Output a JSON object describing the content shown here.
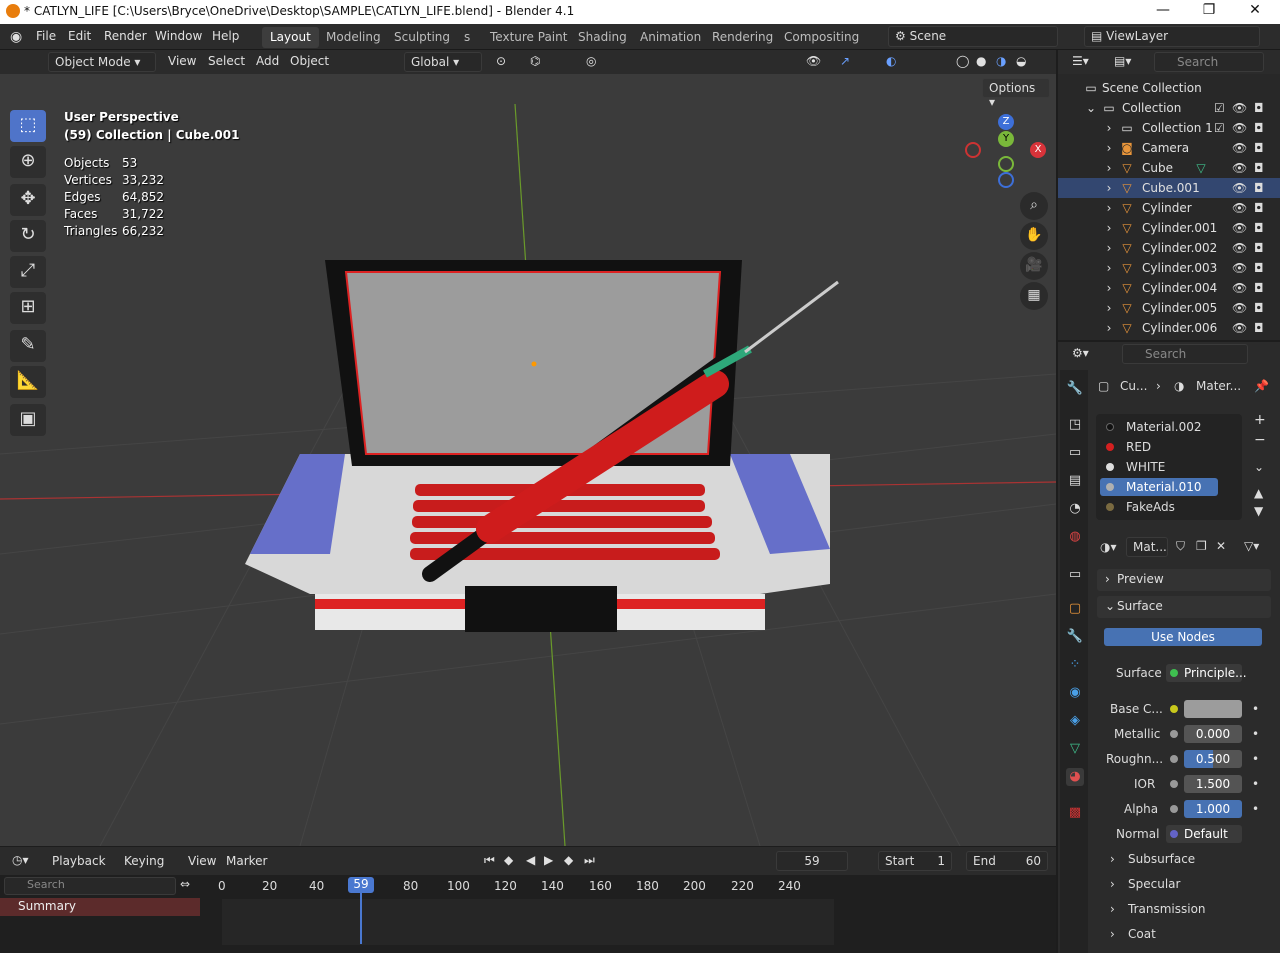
{
  "window": {
    "title": "* CATLYN_LIFE [C:\\Users\\Bryce\\OneDrive\\Desktop\\SAMPLE\\CATLYN_LIFE.blend] - Blender 4.1",
    "minimize": "—",
    "maximize": "❐",
    "close": "✕"
  },
  "menu": [
    "File",
    "Edit",
    "Render",
    "Window",
    "Help"
  ],
  "workspaces": [
    "Layout",
    "Modeling",
    "Sculpting",
    "s",
    "Texture Paint",
    "Shading",
    "Animation",
    "Rendering",
    "Compositing"
  ],
  "scene": {
    "label": "Scene",
    "viewlayer": "ViewLayer"
  },
  "viewport_header": {
    "mode": "Object Mode",
    "menus": [
      "View",
      "Select",
      "Add",
      "Object"
    ],
    "orientation": "Global",
    "options": "Options"
  },
  "overlay": {
    "perspective": "User Perspective",
    "collection": "(59) Collection | Cube.001",
    "stats": [
      {
        "k": "Objects",
        "v": "53"
      },
      {
        "k": "Vertices",
        "v": "33,232"
      },
      {
        "k": "Edges",
        "v": "64,852"
      },
      {
        "k": "Faces",
        "v": "31,722"
      },
      {
        "k": "Triangles",
        "v": "66,232"
      }
    ]
  },
  "gizmo": {
    "x": "X",
    "y": "Y",
    "z": "Z"
  },
  "outliner": {
    "search": "Search",
    "root": "Scene Collection",
    "items": [
      {
        "name": "Collection",
        "icon": "collection-icon"
      },
      {
        "name": "Collection 1",
        "icon": "collection-icon"
      },
      {
        "name": "Camera",
        "icon": "camera-icon"
      },
      {
        "name": "Cube",
        "icon": "mesh-icon"
      },
      {
        "name": "Cube.001",
        "icon": "mesh-icon"
      },
      {
        "name": "Cylinder",
        "icon": "mesh-icon"
      },
      {
        "name": "Cylinder.001",
        "icon": "mesh-icon"
      },
      {
        "name": "Cylinder.002",
        "icon": "mesh-icon"
      },
      {
        "name": "Cylinder.003",
        "icon": "mesh-icon"
      },
      {
        "name": "Cylinder.004",
        "icon": "mesh-icon"
      },
      {
        "name": "Cylinder.005",
        "icon": "mesh-icon"
      },
      {
        "name": "Cylinder.006",
        "icon": "mesh-icon"
      }
    ]
  },
  "properties": {
    "search": "Search",
    "breadcrumb_obj": "Cu...",
    "breadcrumb_mat": "Mater...",
    "materials": [
      {
        "name": "Material.002",
        "color": "#111111"
      },
      {
        "name": "RED",
        "color": "#d42020"
      },
      {
        "name": "WHITE",
        "color": "#dddddd"
      },
      {
        "name": "Material.010",
        "color": "#b0b0b0"
      },
      {
        "name": "FakeAds",
        "color": "#7a6a40"
      }
    ],
    "mat_slot": "Mat...",
    "preview": "Preview",
    "surface": "Surface",
    "use_nodes": "Use Nodes",
    "surface_label": "Surface",
    "surface_value": "Principle...",
    "fields": [
      {
        "label": "Base C...",
        "value": "",
        "dot": "#c8c81c"
      },
      {
        "label": "Metallic",
        "value": "0.000",
        "dot": "#999"
      },
      {
        "label": "Roughn...",
        "value": "0.500",
        "dot": "#999"
      },
      {
        "label": "IOR",
        "value": "1.500",
        "dot": "#999"
      },
      {
        "label": "Alpha",
        "value": "1.000",
        "dot": "#999"
      },
      {
        "label": "Normal",
        "value": "Default",
        "dot": "#6363c7"
      }
    ],
    "subsections": [
      "Subsurface",
      "Specular",
      "Transmission",
      "Coat"
    ]
  },
  "timeline": {
    "menus": [
      "Playback",
      "Keying",
      "View",
      "Marker"
    ],
    "frame": "59",
    "start_label": "Start",
    "start": "1",
    "end_label": "End",
    "end": "60",
    "search": "Search",
    "summary": "Summary",
    "ticks": [
      "0",
      "20",
      "40",
      "59",
      "80",
      "100",
      "120",
      "140",
      "160",
      "180",
      "200",
      "220",
      "240"
    ]
  }
}
